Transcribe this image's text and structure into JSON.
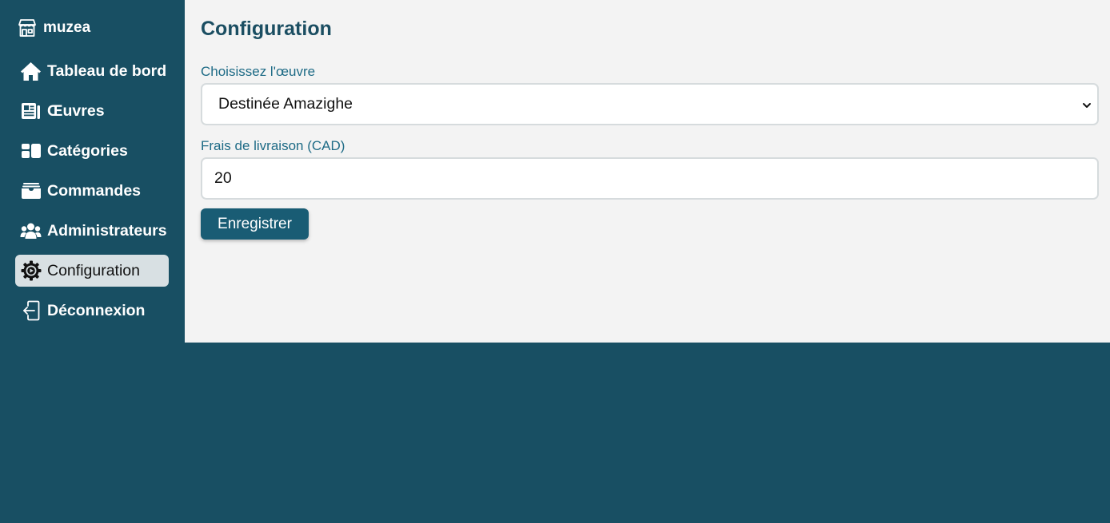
{
  "brand": {
    "name": "muzea",
    "icon": "shop-icon"
  },
  "sidebar": {
    "items": [
      {
        "label": "Tableau de bord",
        "icon": "home-icon",
        "active": false
      },
      {
        "label": "Œuvres",
        "icon": "newspaper-icon",
        "active": false
      },
      {
        "label": "Catégories",
        "icon": "grid-icon",
        "active": false
      },
      {
        "label": "Commandes",
        "icon": "archive-box-icon",
        "active": false
      },
      {
        "label": "Administrateurs",
        "icon": "people-icon",
        "active": false
      },
      {
        "label": "Configuration",
        "icon": "gear-icon",
        "active": true
      },
      {
        "label": "Déconnexion",
        "icon": "logout-icon",
        "active": false
      }
    ]
  },
  "main": {
    "title": "Configuration",
    "oeuvre": {
      "label": "Choisissez l'œuvre",
      "selected": "Destinée Amazighe"
    },
    "frais": {
      "label": "Frais de livraison (CAD)",
      "value": "20"
    },
    "save_label": "Enregistrer"
  },
  "colors": {
    "sidebar_bg": "#184f63",
    "main_bg": "#f3f3f3",
    "accent": "#195c74",
    "label_color": "#1e6b86",
    "active_item_bg": "#d8e0e3"
  }
}
